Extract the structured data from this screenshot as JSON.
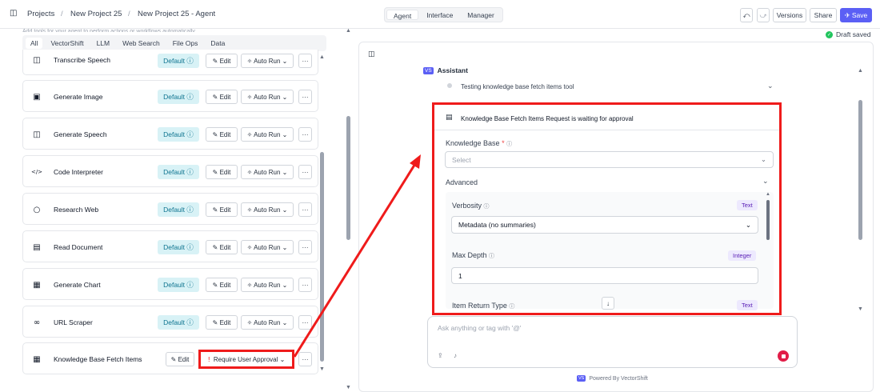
{
  "breadcrumb": {
    "root": "Projects",
    "project": "New Project 25",
    "page": "New Project 25 - Agent",
    "sep": "/"
  },
  "view_tabs": [
    "Agent",
    "Interface",
    "Manager"
  ],
  "toolbar": {
    "undo": "⤺",
    "redo": "⤻",
    "versions": "Versions",
    "share": "Share",
    "save": "Save"
  },
  "status": {
    "draft": "Draft saved"
  },
  "left_hint": "Add tools for your agent to perform actions or workflows automatically.",
  "category_tabs": [
    "All",
    "VectorShift",
    "LLM",
    "Web Search",
    "File Ops",
    "Data"
  ],
  "tools": [
    {
      "name": "Transcribe Speech",
      "icon": "◫"
    },
    {
      "name": "Generate Image",
      "icon": "▣"
    },
    {
      "name": "Generate Speech",
      "icon": "◫"
    },
    {
      "name": "Code Interpreter",
      "icon": "</>"
    },
    {
      "name": "Research Web",
      "icon": "○"
    },
    {
      "name": "Read Document",
      "icon": "▤"
    },
    {
      "name": "Generate Chart",
      "icon": "▦"
    },
    {
      "name": "URL Scraper",
      "icon": "∞"
    },
    {
      "name": "Knowledge Base Fetch Items",
      "icon": "▦"
    }
  ],
  "tool_labels": {
    "default": "Default ⓘ",
    "edit": "✎ Edit",
    "auto_run": "✧ Auto Run ⌄",
    "more": "···",
    "require_approval": "Require User Approval ⌄",
    "edit_kb": "✎ Edit"
  },
  "chat": {
    "assistant_badge": "VS",
    "assistant_label": "Assistant",
    "step_text": "Testing knowledge base fetch items tool",
    "approval_title": "Knowledge Base Fetch Items Request is waiting for approval",
    "kb_label": "Knowledge Base",
    "kb_required": "*",
    "kb_placeholder": "Select",
    "advanced": "Advanced",
    "verbosity_label": "Verbosity",
    "verbosity_type": "Text",
    "verbosity_value": "Metadata (no summaries)",
    "max_depth_label": "Max Depth",
    "max_depth_type": "Integer",
    "max_depth_value": "1",
    "item_return_label": "Item Return Type",
    "item_return_type": "Text",
    "input_placeholder": "Ask anything or tag with '@'",
    "powered_badge": "VS",
    "powered_by": "Powered By VectorShift"
  },
  "colors": {
    "accent": "#5b5ff5",
    "highlight": "#ef1b1b",
    "default_badge_bg": "#d8f2f6"
  }
}
